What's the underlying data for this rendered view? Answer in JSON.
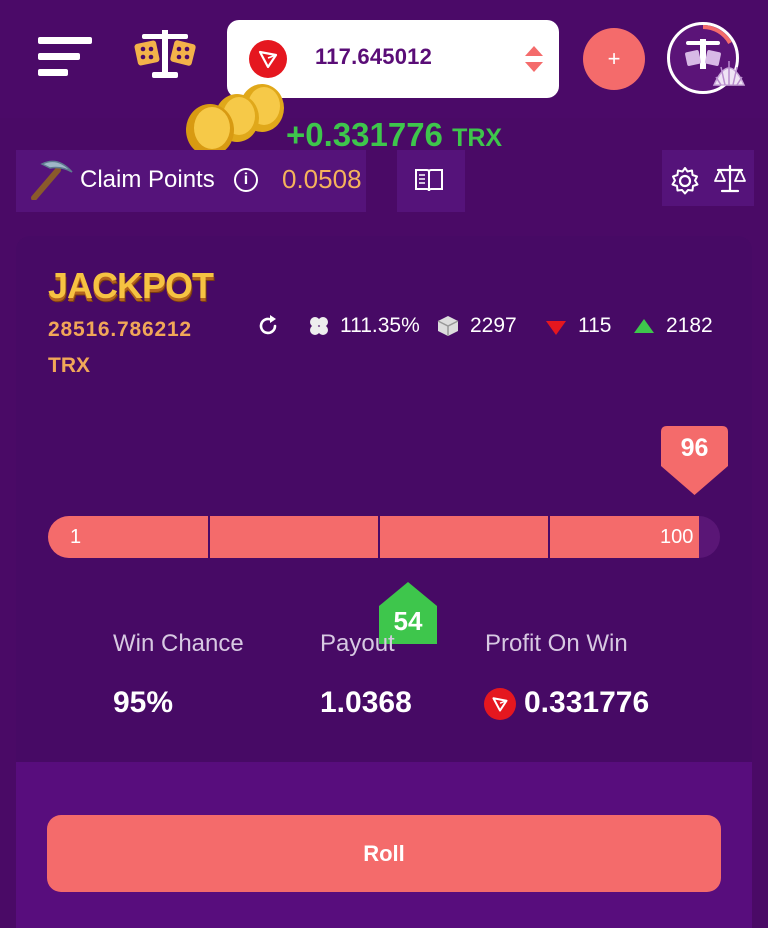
{
  "header": {
    "balance": "117.645012",
    "add_label": "+"
  },
  "win_notice": {
    "amount": "+0.331776",
    "unit": "TRX"
  },
  "claim": {
    "label": "Claim Points",
    "value": "0.0508"
  },
  "jackpot": {
    "title": "JACKPOT",
    "amount": "28516.786212",
    "unit": "TRX"
  },
  "stats": {
    "luck": "111.35%",
    "bets": "2297",
    "losses": "115",
    "wins": "2182"
  },
  "slider": {
    "min": "1",
    "max": "100",
    "target": "96",
    "result": "54",
    "target_value": 96,
    "result_value": 54
  },
  "info": {
    "win_chance_label": "Win Chance",
    "win_chance": "95%",
    "payout_label": "Payout",
    "payout": "1.0368",
    "profit_label": "Profit On Win",
    "profit": "0.331776"
  },
  "roll_label": "Roll",
  "colors": {
    "background": "#4a0a66",
    "accent": "#f46b6b",
    "gold": "#f1a758",
    "green": "#3ec64c",
    "tron_red": "#e5171f"
  }
}
